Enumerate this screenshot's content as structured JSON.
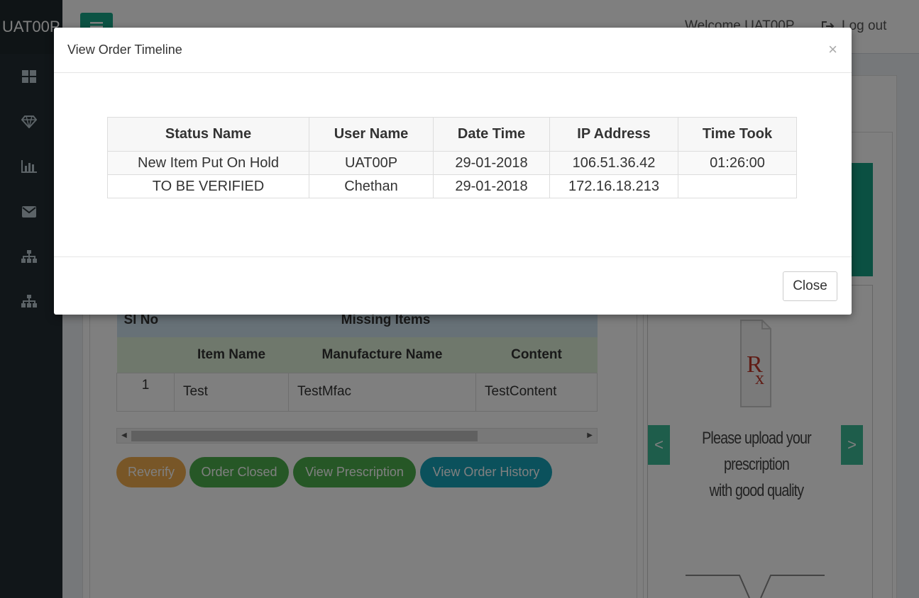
{
  "app": {
    "brand": "UAT00P",
    "welcome_text": "Welcome UAT00P",
    "logout_label": "Log out"
  },
  "sidebar": {
    "items": [
      {
        "icon": "dashboard-icon"
      },
      {
        "icon": "diamond-icon"
      },
      {
        "icon": "bar-chart-icon"
      },
      {
        "icon": "envelope-icon"
      },
      {
        "icon": "sitemap-icon"
      },
      {
        "icon": "sitemap-icon"
      }
    ]
  },
  "background": {
    "missing_items": {
      "sl_no_header": "Sl No",
      "title": "Missing Items",
      "columns": [
        "Item Name",
        "Manufacture Name",
        "Content"
      ],
      "rows": [
        {
          "sl": "1",
          "item": "Test",
          "manufacturer": "TestMfac",
          "content": "TestContent"
        }
      ]
    },
    "actions": {
      "reverify": "Reverify",
      "order_closed": "Order Closed",
      "view_prescription": "View Prescription",
      "view_order_history": "View Order History"
    },
    "prescription_panel": {
      "prev": "<",
      "next": ">",
      "upload_line1": "Please upload your prescription",
      "upload_line2": "with good quality"
    }
  },
  "modal": {
    "title": "View Order Timeline",
    "close_x": "×",
    "close_button": "Close",
    "columns": [
      "Status Name",
      "User Name",
      "Date Time",
      "IP Address",
      "Time Took"
    ],
    "rows": [
      {
        "status": "New Item Put On Hold",
        "user": "UAT00P",
        "date": "29-01-2018",
        "ip": "106.51.36.42",
        "took": "01:26:00"
      },
      {
        "status": "TO BE VERIFIED",
        "user": "Chethan",
        "date": "29-01-2018",
        "ip": "172.16.18.213",
        "took": ""
      }
    ]
  },
  "colors": {
    "sidebar": "#222d32",
    "accent_green": "#18a689",
    "orange": "#f0ad4e",
    "green": "#4cae4c",
    "teal": "#17a2b8"
  }
}
